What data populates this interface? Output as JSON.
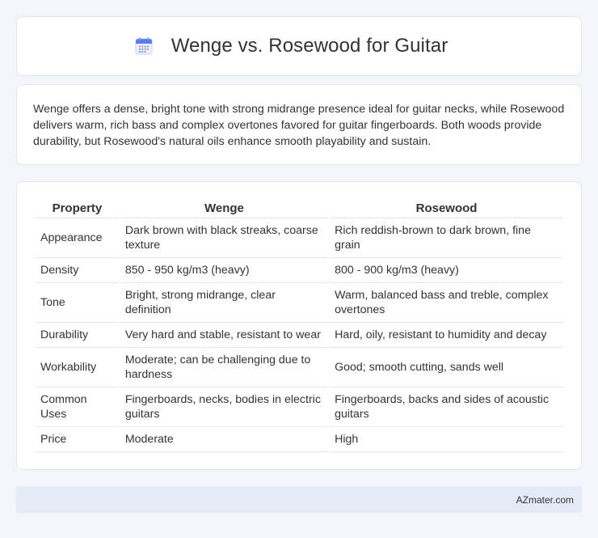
{
  "header": {
    "title": "Wenge vs. Rosewood for Guitar",
    "icon": "calendar-icon"
  },
  "summary": {
    "text": "Wenge offers a dense, bright tone with strong midrange presence ideal for guitar necks, while Rosewood delivers warm, rich bass and complex overtones favored for guitar fingerboards. Both woods provide durability, but Rosewood's natural oils enhance smooth playability and sustain."
  },
  "table": {
    "headers": [
      "Property",
      "Wenge",
      "Rosewood"
    ],
    "rows": [
      {
        "property": "Appearance",
        "wenge": "Dark brown with black streaks, coarse texture",
        "rosewood": "Rich reddish-brown to dark brown, fine grain"
      },
      {
        "property": "Density",
        "wenge": "850 - 950 kg/m3 (heavy)",
        "rosewood": "800 - 900 kg/m3 (heavy)"
      },
      {
        "property": "Tone",
        "wenge": "Bright, strong midrange, clear definition",
        "rosewood": "Warm, balanced bass and treble, complex overtones"
      },
      {
        "property": "Durability",
        "wenge": "Very hard and stable, resistant to wear",
        "rosewood": "Hard, oily, resistant to humidity and decay"
      },
      {
        "property": "Workability",
        "wenge": "Moderate; can be challenging due to hardness",
        "rosewood": "Good; smooth cutting, sands well"
      },
      {
        "property": "Common Uses",
        "wenge": "Fingerboards, necks, bodies in electric guitars",
        "rosewood": "Fingerboards, backs and sides of acoustic guitars"
      },
      {
        "property": "Price",
        "wenge": "Moderate",
        "rosewood": "High"
      }
    ]
  },
  "footer": {
    "brand": "AZmater.com"
  },
  "colors": {
    "background": "#f2f5fa",
    "card": "#ffffff",
    "footer": "#e4ebf6",
    "icon_accent": "#5b7de8"
  }
}
